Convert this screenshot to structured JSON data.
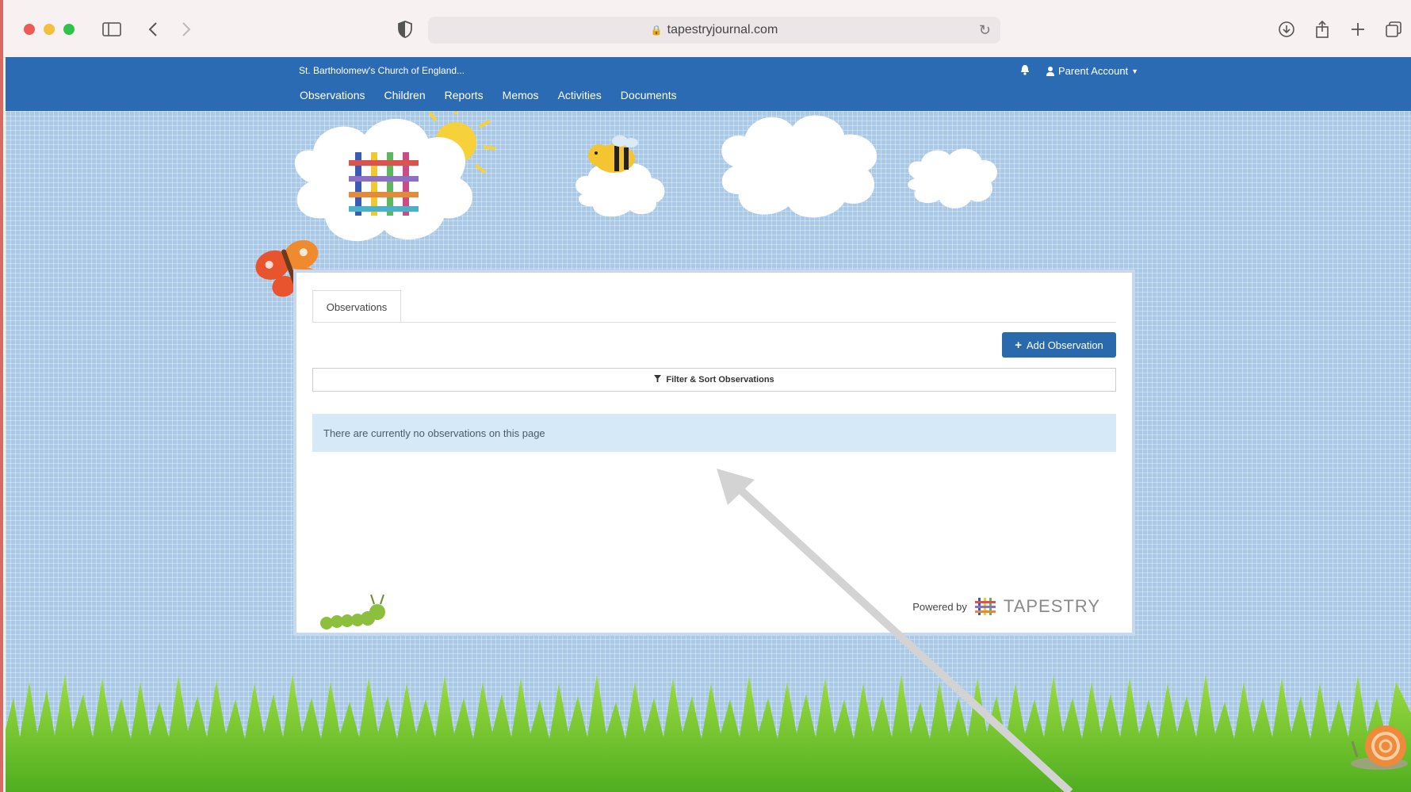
{
  "browser": {
    "url": "tapestryjournal.com"
  },
  "navbar": {
    "school": "St. Bartholomew's Church of England...",
    "account": "Parent Account",
    "links": [
      "Observations",
      "Children",
      "Reports",
      "Memos",
      "Activities",
      "Documents"
    ]
  },
  "panel": {
    "tab": "Observations",
    "add_button": "Add Observation",
    "filter_label": "Filter & Sort Observations",
    "empty_message": "There are currently no observations on this page",
    "powered_by": "Powered by",
    "brand": "TAPESTRY"
  },
  "colors": {
    "nav": "#2b6bb3",
    "button": "#2a6aac",
    "info": "#d6e9f6"
  }
}
